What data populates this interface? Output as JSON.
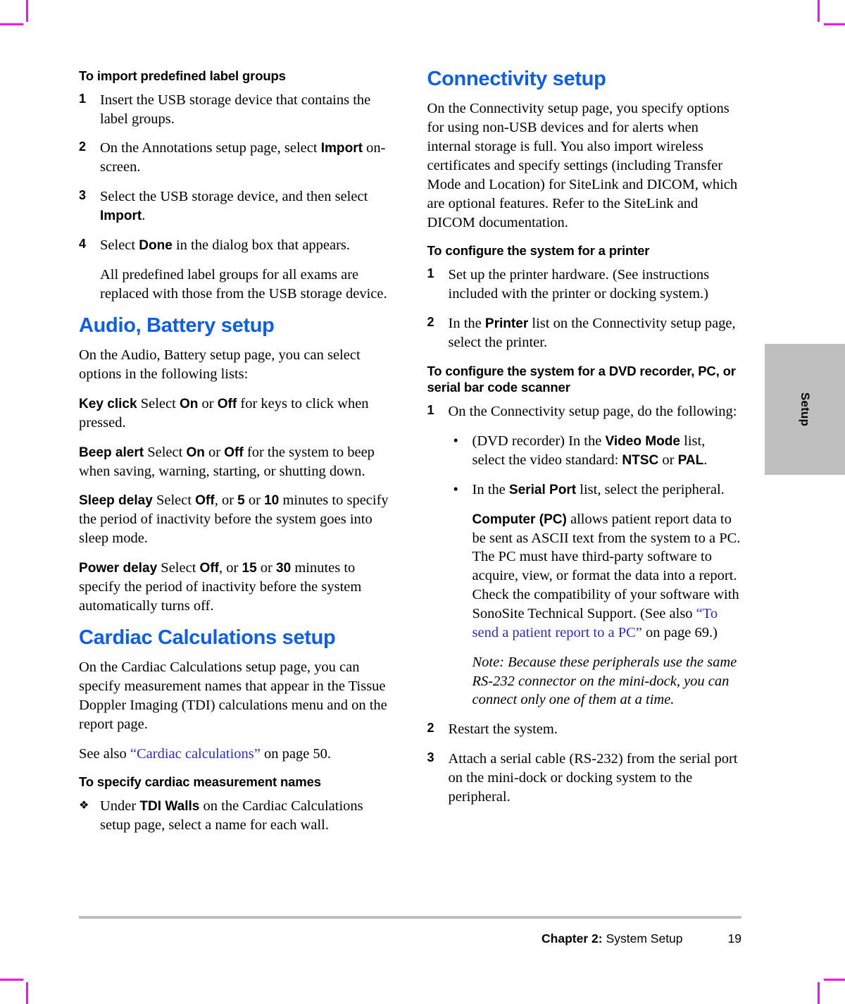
{
  "side_tab": {
    "label": "Setup"
  },
  "footer": {
    "chapter": "Chapter 2:",
    "chapter_title": "System Setup",
    "page_number": "19"
  },
  "colors": {
    "section_heading_blue": "#0d5ee8",
    "cross_reference_blue": "#2b2bcc",
    "rule_gray": "#bfbfbf",
    "tab_gray": "#bfbfbf",
    "crop_mark_magenta": "#f50df5"
  },
  "left_column": {
    "import_labels": {
      "heading": "To import predefined label groups",
      "step1_num": "1",
      "step1": "Insert the USB storage device that contains the label groups.",
      "step2_num": "2",
      "step2_a": "On the Annotations setup page, select ",
      "step2_b": "Import",
      "step2_c": " on-screen.",
      "step3_num": "3",
      "step3_a": "Select the USB storage device, and then select ",
      "step3_b": "Import",
      "step3_c": ".",
      "step4_num": "4",
      "step4_a": "Select ",
      "step4_b": "Done",
      "step4_c": " in the dialog box that appears.",
      "step4_result": "All predefined label groups for all exams are replaced with those from the USB storage device."
    },
    "audio_battery": {
      "heading": "Audio, Battery setup",
      "intro": "On the Audio, Battery setup page, you can select options in the following lists:",
      "key_click_label": "Key click",
      "key_click_a": " Select ",
      "key_click_on": "On",
      "key_click_or": " or ",
      "key_click_off": "Off",
      "key_click_b": " for keys to click when pressed.",
      "beep_alert_label": "Beep alert",
      "beep_alert_a": " Select ",
      "beep_alert_on": "On",
      "beep_alert_or": " or ",
      "beep_alert_off": "Off",
      "beep_alert_b": " for the system to beep when saving, warning, starting, or shutting down.",
      "sleep_delay_label": "Sleep delay",
      "sleep_delay_a": " Select ",
      "sleep_delay_off": "Off",
      "sleep_delay_b": ", or ",
      "sleep_delay_5": "5",
      "sleep_delay_c": " or ",
      "sleep_delay_10": "10",
      "sleep_delay_d": " minutes to specify the period of inactivity before the system goes into sleep mode.",
      "power_delay_label": "Power delay",
      "power_delay_a": " Select ",
      "power_delay_off": "Off",
      "power_delay_b": ", or ",
      "power_delay_15": "15",
      "power_delay_c": " or ",
      "power_delay_30": "30",
      "power_delay_d": " minutes to specify the period of inactivity before the system automatically turns off."
    },
    "cardiac": {
      "heading": "Cardiac Calculations setup",
      "intro": "On the Cardiac Calculations setup page, you can specify measurement names that appear in the Tissue Doppler Imaging (TDI) calculations menu and on the report page.",
      "see_also_a": "See also ",
      "see_also_link": "“Cardiac calculations”",
      "see_also_b": " on page 50.",
      "proc_heading": "To specify cardiac measurement names",
      "bullet_marker": "❖",
      "bullet_a": "Under ",
      "bullet_b": "TDI Walls",
      "bullet_c": " on the Cardiac Calculations setup page, select a name for each wall."
    }
  },
  "right_column": {
    "connectivity": {
      "heading": "Connectivity setup",
      "intro": "On the Connectivity setup page, you specify options for using non-USB devices and for alerts when internal storage is full. You also import wireless certificates and specify settings (including Transfer Mode and Location) for SiteLink and DICOM, which are optional features. Refer to the SiteLink and DICOM documentation."
    },
    "printer_proc": {
      "heading": "To configure the system for a printer",
      "step1_num": "1",
      "step1": "Set up the printer hardware. (See instructions included with the printer or docking system.)",
      "step2_num": "2",
      "step2_a": "In the ",
      "step2_b": "Printer",
      "step2_c": " list on the Connectivity setup page, select the printer."
    },
    "dvd_proc": {
      "heading": "To configure the system for a DVD recorder, PC, or serial bar code scanner",
      "step1_num": "1",
      "step1": "On the Connectivity setup page, do the following:",
      "bullet_marker": "•",
      "sub1_a": "(DVD recorder) In the ",
      "sub1_b": "Video Mode",
      "sub1_c": " list, select the video standard: ",
      "sub1_d": "NTSC",
      "sub1_e": " or ",
      "sub1_f": "PAL",
      "sub1_g": ".",
      "sub2_a": "In the ",
      "sub2_b": "Serial Port",
      "sub2_c": " list, select the peripheral.",
      "pc_label": "Computer (PC)",
      "pc_text_a": " allows patient report data to be sent as ASCII text from the system to a PC. The PC must have third-party software to acquire, view, or format the data into a report. Check the compatibility of your software with SonoSite Technical Support. (See also ",
      "pc_link": "“To send a patient report to a PC”",
      "pc_text_b": " on page 69.)",
      "note_label": "Note:",
      "note_text": "  Because these peripherals use the same RS-232 connector on the mini-dock, you can connect only one of them at a time.",
      "step2_num": "2",
      "step2": "Restart the system.",
      "step3_num": "3",
      "step3": "Attach a serial cable (RS-232) from the serial port on the mini-dock or docking system to the peripheral."
    }
  }
}
